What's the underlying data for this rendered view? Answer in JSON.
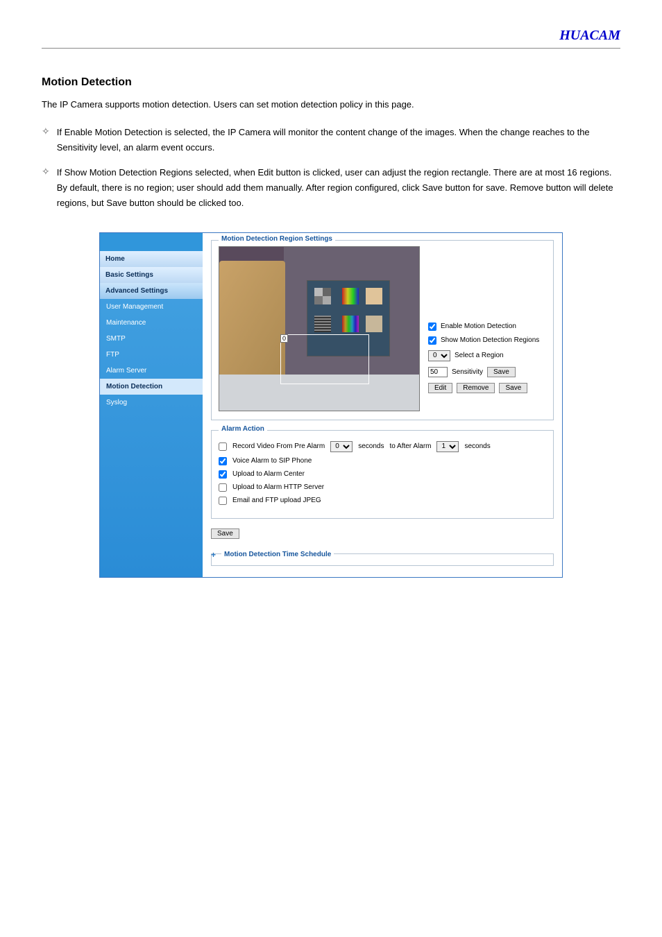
{
  "brand": "HUACAM",
  "heading": "Motion Detection",
  "intro": "The IP Camera supports motion detection. Users can set motion detection policy in this page.",
  "bullet1": "If Enable Motion Detection is selected, the IP Camera will monitor the content change of the images. When the change reaches to the Sensitivity level, an alarm event occurs.",
  "bullet2": "If Show Motion Detection Regions selected, when Edit button is clicked, user can adjust the region rectangle. There are at most 16 regions. By default, there is no region; user should add them manually. After region configured, click Save button for save. Remove button will delete regions, but Save button should be clicked too.",
  "sidebar": {
    "home": "Home",
    "basic": "Basic Settings",
    "advanced": "Advanced Settings",
    "user_mgmt": "User Management",
    "maintenance": "Maintenance",
    "smtp": "SMTP",
    "ftp": "FTP",
    "alarm_server": "Alarm Server",
    "motion": "Motion Detection",
    "syslog": "Syslog"
  },
  "panel": {
    "legend_region": "Motion Detection Region Settings",
    "legend_alarm": "Alarm Action",
    "region_label": "0",
    "enable_motion": "Enable Motion Detection",
    "show_regions": "Show Motion Detection Regions",
    "select_region": "Select a Region",
    "select_region_value": "0",
    "sensitivity_label": "Sensitivity",
    "sensitivity_value": "50",
    "save": "Save",
    "edit": "Edit",
    "remove": "Remove",
    "record_pre": "Record Video From Pre Alarm",
    "seconds": "seconds",
    "to_after": "to After Alarm",
    "pre_val": "0",
    "after_val": "1",
    "voice_alarm": "Voice Alarm to SIP Phone",
    "upload_center": "Upload to Alarm Center",
    "upload_http": "Upload to Alarm HTTP Server",
    "email_ftp": "Email and FTP upload JPEG",
    "schedule_title": "Motion Detection Time Schedule"
  }
}
